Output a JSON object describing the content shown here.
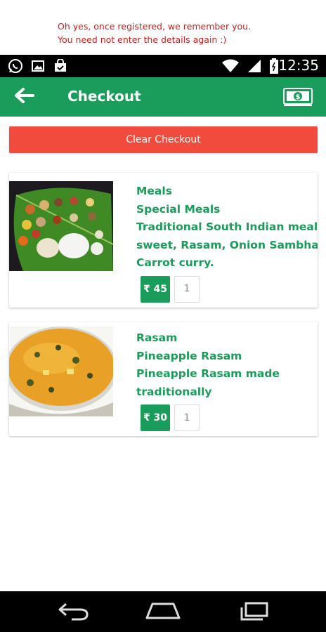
{
  "caption": {
    "line1": "Oh yes, once registered, we remember you.",
    "line2": "You need not enter the details again :)"
  },
  "status_bar": {
    "time": "12:35",
    "icons": [
      "whatsapp-icon",
      "gallery-icon",
      "shopping-bag-icon",
      "wifi-icon",
      "signal-icon",
      "battery-icon"
    ]
  },
  "app_bar": {
    "title": "Checkout",
    "back_icon": "arrow-left-icon",
    "action_icon": "money-icon"
  },
  "clear_button": {
    "label": "Clear Checkout"
  },
  "items": [
    {
      "category": "Meals",
      "name": "Special Meals",
      "description_line1": "Traditional South Indian meals wit",
      "description_line2": "sweet, Rasam, Onion Sambhar,",
      "description_line3": "Carrot curry.",
      "price": "₹ 45",
      "quantity": "1"
    },
    {
      "category": "Rasam",
      "name": "Pineapple Rasam",
      "description_line1": "Pineapple Rasam made",
      "description_line2": "traditionally",
      "price": "₹ 30",
      "quantity": "1"
    }
  ],
  "nav_bar": {
    "icons": [
      "back-nav-icon",
      "home-nav-icon",
      "recents-nav-icon"
    ]
  },
  "colors": {
    "primary_green": "#1a9c5b",
    "clear_red": "#f04b3d",
    "caption_red": "#d21b1b"
  }
}
